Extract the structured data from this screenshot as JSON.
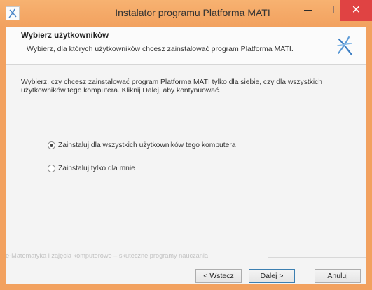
{
  "window": {
    "title": "Instalator programu Platforma MATI",
    "close_glyph": "✕",
    "icons": {
      "app": "app-logo-icon",
      "minimize": "minimize-icon",
      "maximize": "maximize-icon",
      "close": "close-icon"
    },
    "accent_color": "#f2a15f",
    "close_color": "#e04343"
  },
  "header": {
    "title": "Wybierz użytkowników",
    "subtitle": "Wybierz, dla których użytkowników chcesz zainstalować program Platforma MATI.",
    "logo_icon": "mati-logo-icon"
  },
  "body": {
    "description": "Wybierz, czy chcesz zainstalować program Platforma MATI tylko dla siebie, czy dla wszystkich użytkowników tego komputera. Kliknij Dalej, aby kontynuować.",
    "options": [
      {
        "label": "Zainstaluj dla wszystkich użytkowników tego komputera",
        "selected": true
      },
      {
        "label": "Zainstaluj tylko dla mnie",
        "selected": false
      }
    ]
  },
  "footer": {
    "brand_text": "e-Matematyka i zajęcia komputerowe – skuteczne programy nauczania",
    "buttons": {
      "back": "< Wstecz",
      "next": "Dalej >",
      "cancel": "Anuluj"
    }
  }
}
